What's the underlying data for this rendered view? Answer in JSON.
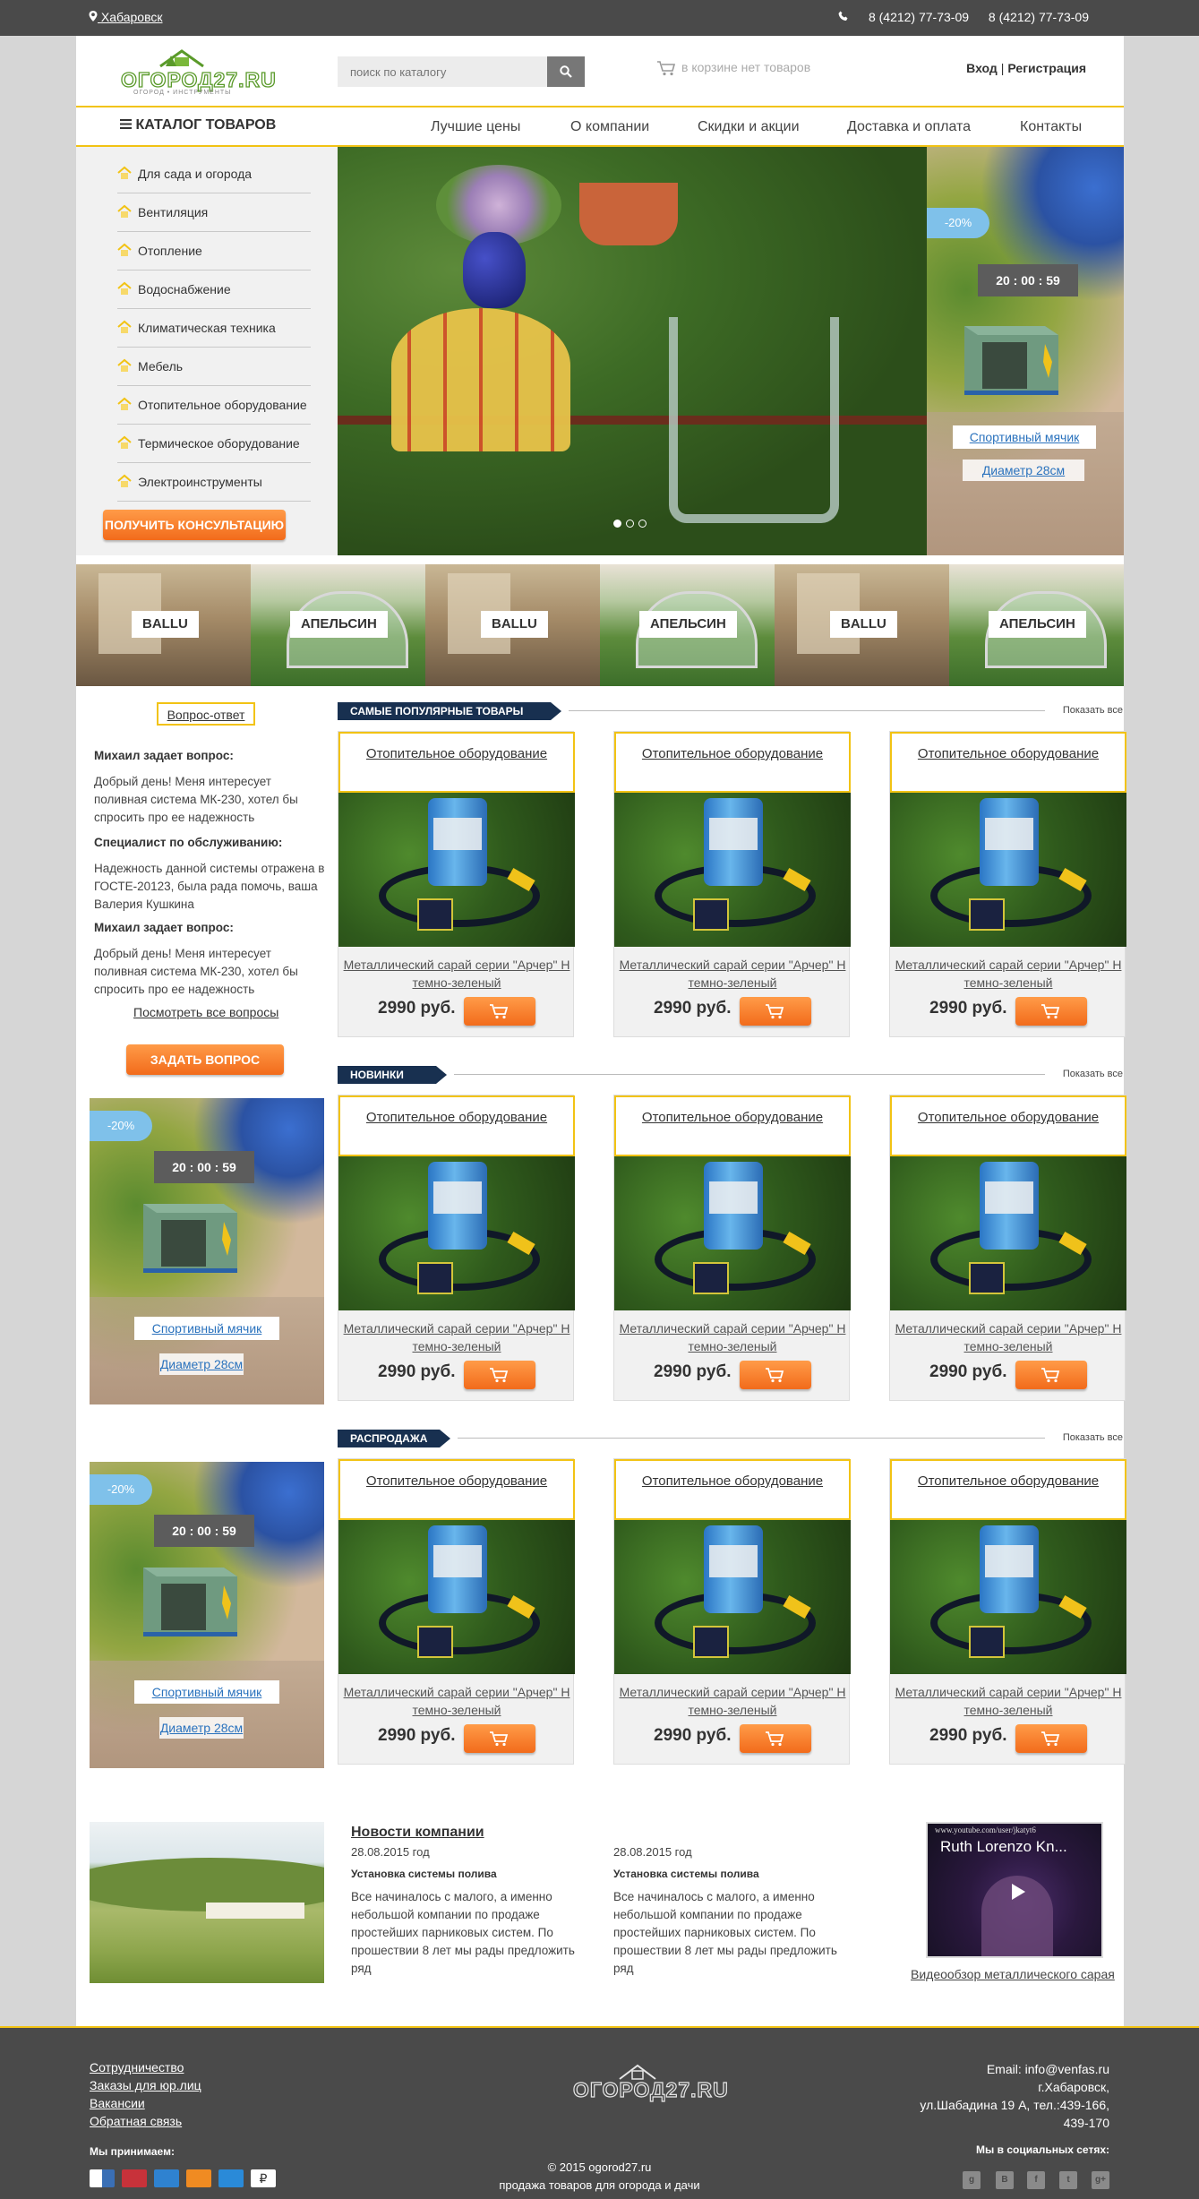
{
  "topbar": {
    "city": "Хабаровск",
    "phone1": "8 (4212) 77-73-09",
    "phone2": "8 (4212) 77-73-09"
  },
  "header": {
    "logo_text": "ОГОРОД27.RU",
    "logo_tagline": "ОГОРОД • ИНСТРУМЕНТЫ",
    "search_placeholder": "поиск по каталогу",
    "cart_text": "в корзине нет товаров",
    "login": "Вход",
    "separator": "|",
    "register": "Регистрация"
  },
  "nav": {
    "catalog": "КАТАЛОГ ТОВАРОВ",
    "items": [
      "Лучшие цены",
      "О компании",
      "Скидки и акции",
      "Доставка и оплата",
      "Контакты"
    ]
  },
  "categories": {
    "items": [
      "Для сада и огорода",
      "Вентиляция",
      "Отопление",
      "Водоснабжение",
      "Климатическая техника",
      "Мебель",
      "Отопительное оборудование",
      "Термическое оборудование",
      "Электроинструменты"
    ],
    "button": "ПОЛУЧИТЬ КОНСУЛЬТАЦИЮ"
  },
  "promo": {
    "discount": "-20%",
    "timer": "20 : 00 : 59",
    "label1": "Спортивный мячик",
    "label2": "Диаметр 28см"
  },
  "brands": [
    "BALLU",
    "АПЕЛЬСИН",
    "BALLU",
    "АПЕЛЬСИН",
    "BALLU",
    "АПЕЛЬСИН"
  ],
  "qa": {
    "title": "Вопрос-ответ",
    "entries": [
      {
        "head": "Михаил задает вопрос:",
        "text": "Добрый день! Меня интересует поливная система МК-230, хотел бы спросить про ее надежность"
      },
      {
        "head": "Специалист по обслуживанию:",
        "text": "Надежность данной системы отражена в ГОСТЕ-20123, была рада помочь, ваша Валерия Кушкина"
      },
      {
        "head": "Михаил задает вопрос:",
        "text": "Добрый день! Меня интересует поливная система МК-230, хотел бы спросить про ее надежность"
      }
    ],
    "all": "Посмотреть все вопросы",
    "ask": "ЗАДАТЬ ВОПРОС"
  },
  "sections": [
    {
      "title": "САМЫЕ ПОПУЛЯРНЫЕ ТОВАРЫ",
      "all": "Показать все"
    },
    {
      "title": "НОВИНКИ",
      "all": "Показать все"
    },
    {
      "title": "РАСПРОДАЖА",
      "all": "Показать все"
    }
  ],
  "product": {
    "title": "Отопительное оборудование",
    "name": "Металлический сарай серии \"Арчер\" Н темно-зеленый",
    "price": "2990 руб."
  },
  "news": {
    "title": "Новости компании",
    "items": [
      {
        "date": "28.08.2015 год",
        "head": "Установка системы полива",
        "body": "Все начиналось с малого, а именно небольшой компании по продаже простейших парниковых систем. По прошествии 8 лет мы рады предложить ряд"
      },
      {
        "date": "28.08.2015 год",
        "head": "Установка системы полива",
        "body": "Все начиналось с малого, а именно небольшой компании по продаже простейших парниковых систем. По прошествии 8 лет мы рады предложить ряд"
      }
    ]
  },
  "video": {
    "url": "www.youtube.com/user/jkatyt6",
    "title": "Ruth Lorenzo Kn...",
    "caption": "Видеообзор металлического сарая"
  },
  "footer": {
    "links": [
      "Сотрудничество",
      "Заказы для юр.лиц",
      "Вакансии",
      "Обратная связь"
    ],
    "accept": "Мы принимаем:",
    "logo_text": "ОГОРОД27.RU",
    "copy1": "© 2015 ogorod27.ru",
    "copy2": "продажа товаров для огорода и дачи",
    "email": "Email: info@venfas.ru",
    "city": "г.Хабаровск,",
    "address": "ул.Шабадина 19 А, тел.:439-166,",
    "tel2": "439-170",
    "social": "Мы в социальных сетях:",
    "social_icons": [
      "g",
      "В",
      "f",
      "t",
      "g+"
    ],
    "colors": {
      "accent": "#f2c314",
      "dark": "#4a4a4a",
      "orange": "#f26b1b",
      "navy": "#183050"
    }
  }
}
